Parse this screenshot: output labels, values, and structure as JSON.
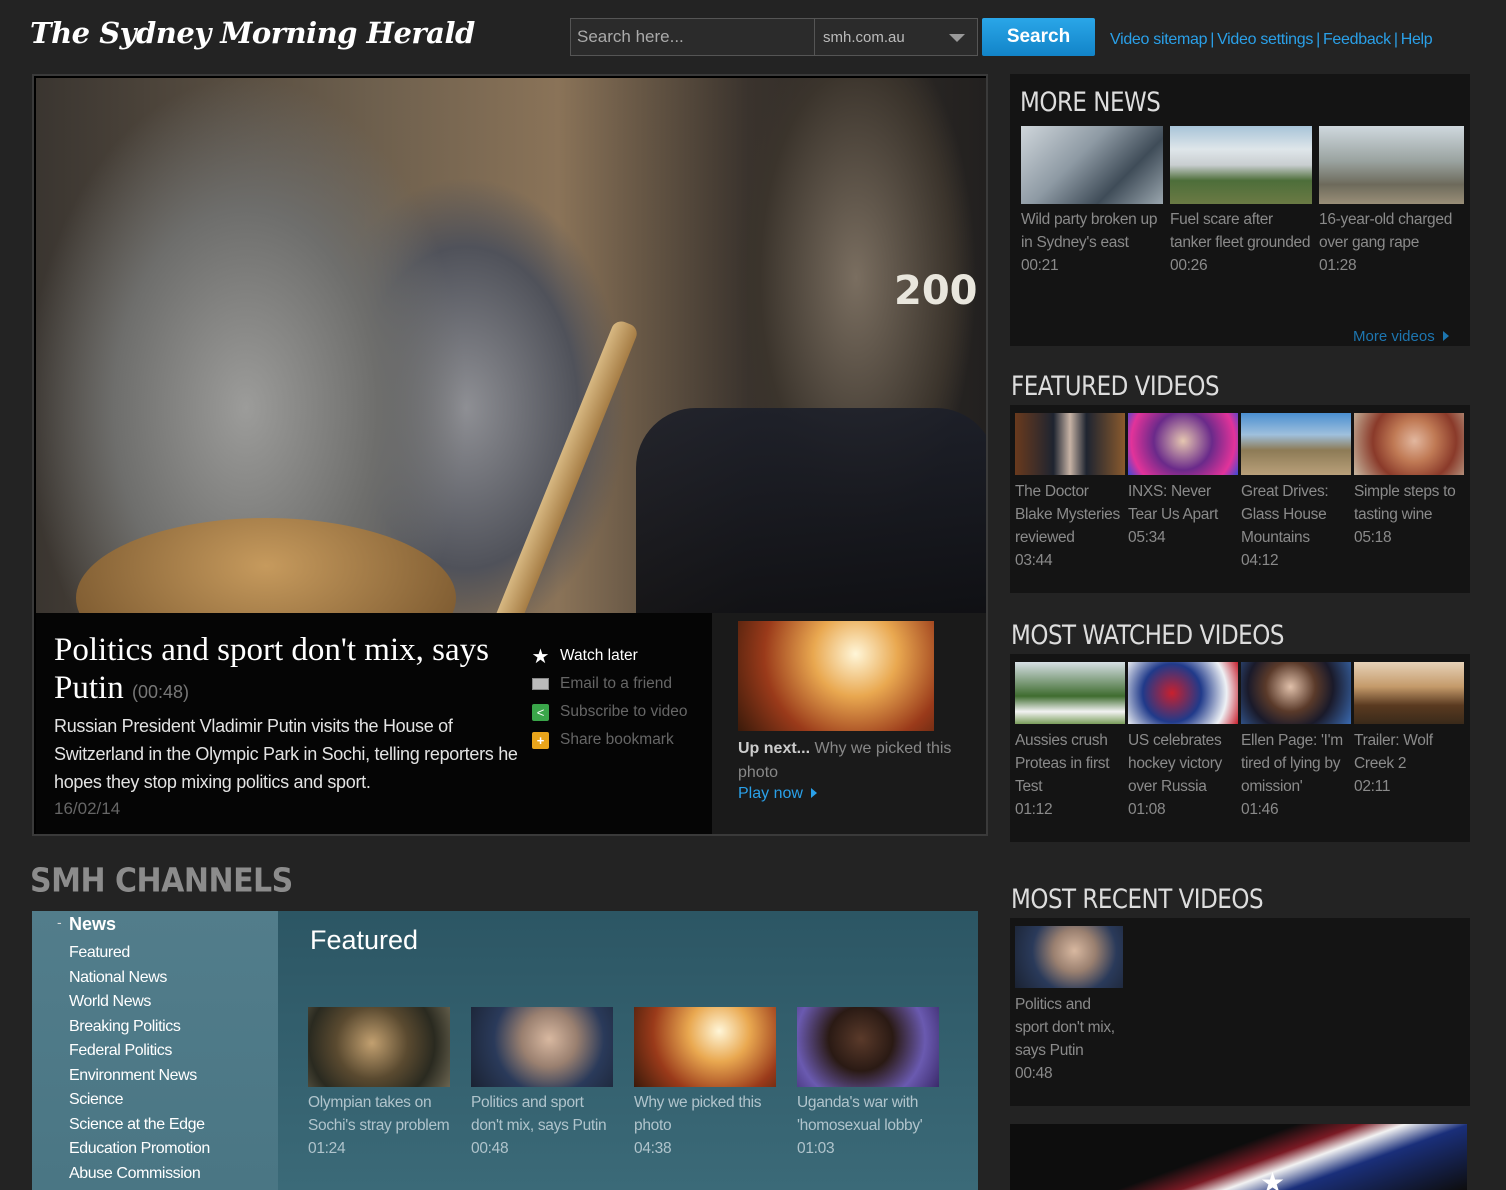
{
  "header": {
    "logo": "The Sydney Morning Herald",
    "search_placeholder": "Search here...",
    "site_select": "smh.com.au",
    "search_button": "Search",
    "links": [
      "Video sitemap",
      "Video settings",
      "Feedback",
      "Help"
    ]
  },
  "player": {
    "headline": "Politics and sport don't mix, says Putin",
    "duration": "(00:48)",
    "description": "Russian President Vladimir Putin visits the House of Switzerland in the Olympic Park in Sochi, telling reporters he hopes they stop mixing politics and sport.",
    "date": "16/02/14",
    "video_overlay": "200",
    "actions": [
      "Watch later",
      "Email to a friend",
      "Subscribe to video",
      "Share bookmark"
    ],
    "up_next": {
      "prefix": "Up next...",
      "title": "Why we picked this photo",
      "play": "Play now"
    }
  },
  "more_news": {
    "title": "MORE NEWS",
    "more_link": "More videos",
    "items": [
      {
        "title": "Wild party broken up in Sydney's east",
        "time": "00:21",
        "icon": "hospital-thumb"
      },
      {
        "title": "Fuel scare after tanker fleet grounded",
        "time": "00:26",
        "icon": "cootes-thumb"
      },
      {
        "title": "16-year-old charged over gang rape",
        "time": "01:28",
        "icon": "park-thumb"
      }
    ]
  },
  "featured_videos": {
    "title": "FEATURED VIDEOS",
    "items": [
      {
        "title": "The Doctor Blake Mysteries reviewed",
        "time": "03:44"
      },
      {
        "title": "INXS: Never Tear Us Apart",
        "time": "05:34"
      },
      {
        "title": "Great Drives: Glass House Mountains",
        "time": "04:12"
      },
      {
        "title": "Simple steps to tasting wine",
        "time": "05:18"
      }
    ]
  },
  "most_watched": {
    "title": "MOST WATCHED VIDEOS",
    "items": [
      {
        "title": "Aussies crush Proteas in first Test",
        "time": "01:12"
      },
      {
        "title": "US celebrates hockey victory over Russia",
        "time": "01:08"
      },
      {
        "title": "Ellen Page: 'I'm tired of lying by omission'",
        "time": "01:46"
      },
      {
        "title": "Trailer: Wolf Creek 2",
        "time": "02:11"
      }
    ]
  },
  "most_recent": {
    "title": "MOST RECENT VIDEOS",
    "items": [
      {
        "title": "Politics and sport don't mix, says Putin",
        "time": "00:48"
      }
    ]
  },
  "channels": {
    "title": "SMH CHANNELS",
    "nav_head": "News",
    "nav_items": [
      "Featured",
      "National News",
      "World News",
      "Breaking Politics",
      "Federal Politics",
      "Environment News",
      "Science",
      "Science at the Edge",
      "Education Promotion",
      "Abuse Commission"
    ],
    "section_title": "Featured",
    "cards": [
      {
        "title": "Olympian takes on Sochi's stray problem",
        "time": "01:24"
      },
      {
        "title": "Politics and sport don't mix, says Putin",
        "time": "00:48"
      },
      {
        "title": "Why we picked this photo",
        "time": "04:38"
      },
      {
        "title": "Uganda's war with 'homosexual lobby'",
        "time": "01:03"
      }
    ]
  }
}
